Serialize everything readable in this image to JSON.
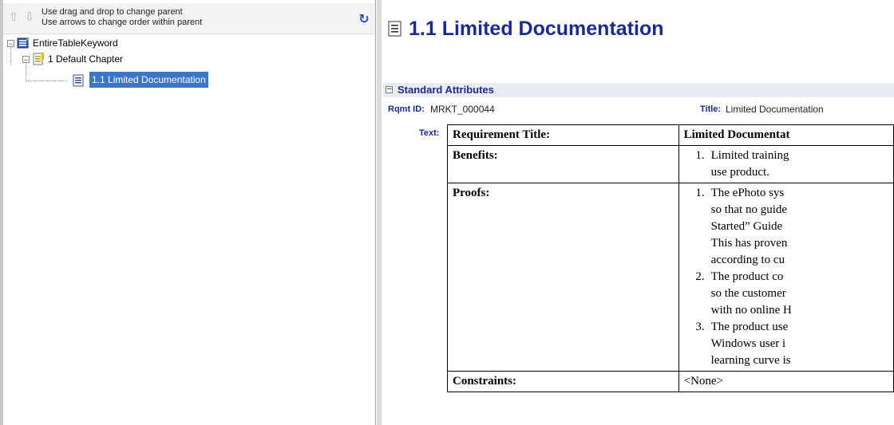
{
  "toolbar": {
    "move_up": "⇧",
    "move_down": "⇩",
    "hint_line1": "Use drag and drop to change parent",
    "hint_line2": "Use arrows to change order within parent",
    "refresh": "↻"
  },
  "tree": {
    "root": {
      "label": "EntireTableKeyword",
      "expander": "−"
    },
    "chapter": {
      "label": "1 Default Chapter",
      "expander": "−"
    },
    "requirement": {
      "label": "1.1 Limited Documentation"
    }
  },
  "document": {
    "title": "1.1 Limited Documentation",
    "section": {
      "title": "Standard Attributes",
      "toggle": "−"
    },
    "rqmt_id_label": "Rqmt ID:",
    "rqmt_id_value": "MRKT_000044",
    "title_label": "Title:",
    "title_value": "Limited Documentation",
    "text_label": "Text:",
    "table": {
      "rows": [
        {
          "key": "Requirement Title:",
          "value": "Limited Documentat"
        },
        {
          "key": "Benefits:",
          "items": [
            {
              "num": "1.",
              "lines": [
                "Limited training",
                "use product."
              ]
            }
          ]
        },
        {
          "key": "Proofs:",
          "items": [
            {
              "num": "1.",
              "lines": [
                "The ePhoto sys",
                "so that no guide",
                "Started” Guide",
                "This has proven",
                "according to cu"
              ]
            },
            {
              "num": "2.",
              "lines": [
                "The product co",
                "so the customer",
                "with no online H"
              ]
            },
            {
              "num": "3.",
              "lines": [
                "The product use",
                "Windows user i",
                "learning curve is"
              ]
            }
          ]
        },
        {
          "key": "Constraints:",
          "value": "<None>"
        }
      ]
    }
  },
  "colors": {
    "accent_blue": "#1b2a8c",
    "selection": "#3a76c9",
    "section_bg": "#e9ebf5"
  }
}
